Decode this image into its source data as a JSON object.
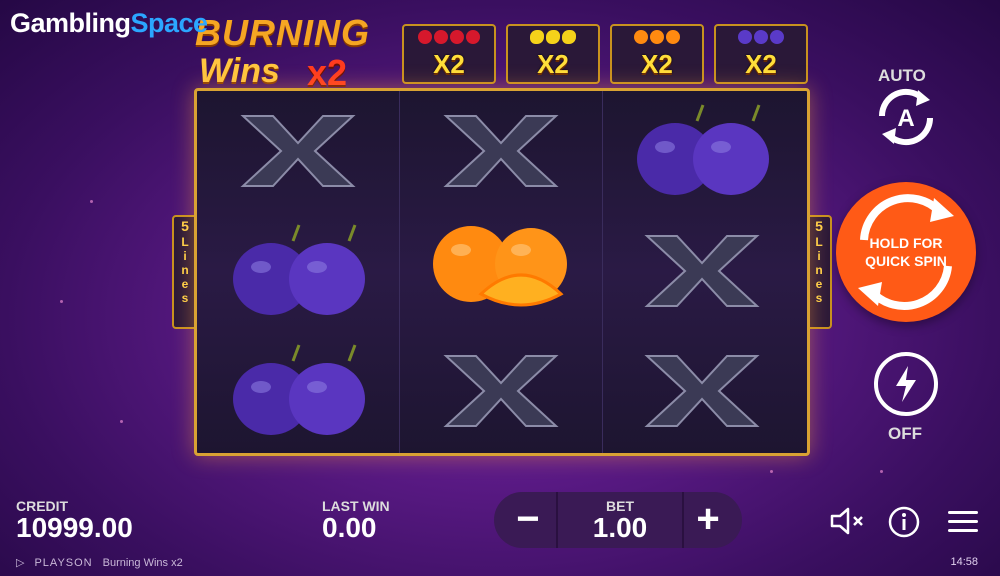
{
  "watermark": {
    "part1": "Gambling",
    "part2": "Space"
  },
  "logo": {
    "line1": "BURNING",
    "line2": "Wins",
    "line3": "x2"
  },
  "multipliers": [
    {
      "label": "X2",
      "fruit": "cherry",
      "color": "#d6182c"
    },
    {
      "label": "X2",
      "fruit": "lemon",
      "color": "#f5d21a"
    },
    {
      "label": "X2",
      "fruit": "orange",
      "color": "#ff8a10"
    },
    {
      "label": "X2",
      "fruit": "plum",
      "color": "#5a3ac8"
    }
  ],
  "reels": [
    [
      "x",
      "plum",
      "plum"
    ],
    [
      "x",
      "orange",
      "x"
    ],
    [
      "plum",
      "x",
      "x"
    ]
  ],
  "lines_badge": {
    "count": "5",
    "word": "Lines"
  },
  "controls": {
    "auto_label": "AUTO",
    "auto_letter": "A",
    "spin_line1": "HOLD FOR",
    "spin_line2": "QUICK SPIN",
    "turbo_label": "OFF"
  },
  "bottom": {
    "credit_label": "CREDIT",
    "credit_value": "10999.00",
    "lastwin_label": "LAST WIN",
    "lastwin_value": "0.00",
    "bet_label": "BET",
    "bet_value": "1.00",
    "minus": "−",
    "plus": "+"
  },
  "footer": {
    "brand": "PLAYSON",
    "game": "Burning Wins x2",
    "time": "14:58"
  },
  "colors": {
    "accent": "#ff5a16",
    "frame": "#d9a233",
    "plum": "#4a2aa8",
    "orange": "#ff8a10"
  }
}
